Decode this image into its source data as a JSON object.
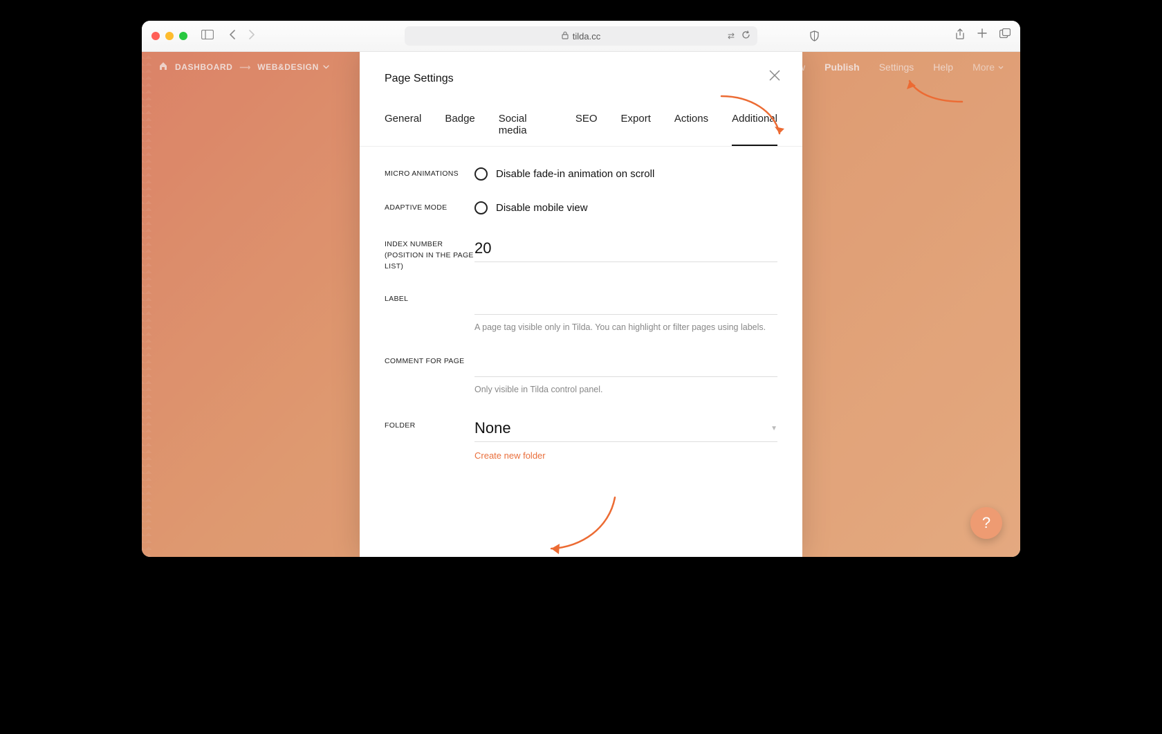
{
  "browser": {
    "url": "tilda.cc"
  },
  "topbar": {
    "dashboard": "DASHBOARD",
    "project": "WEB&DESIGN",
    "preview": "Preview",
    "publish": "Publish",
    "settings": "Settings",
    "help": "Help",
    "more": "More"
  },
  "modal": {
    "title": "Page Settings",
    "tabs": {
      "general": "General",
      "badge": "Badge",
      "social": "Social media",
      "seo": "SEO",
      "export": "Export",
      "actions": "Actions",
      "additional": "Additional"
    },
    "fields": {
      "micro_animations": {
        "label": "MICRO ANIMATIONS",
        "option": "Disable fade-in animation on scroll"
      },
      "adaptive_mode": {
        "label": "ADAPTIVE MODE",
        "option": "Disable mobile view"
      },
      "index": {
        "label": "INDEX NUMBER (POSITION IN THE PAGE LIST)",
        "value": "20"
      },
      "pagelabel": {
        "label": "LABEL",
        "value": "",
        "hint": "A page tag visible only in Tilda. You can highlight or filter pages using labels."
      },
      "comment": {
        "label": "COMMENT FOR PAGE",
        "value": "",
        "hint": "Only visible in Tilda control panel."
      },
      "folder": {
        "label": "FOLDER",
        "value": "None",
        "create_link": "Create new folder"
      }
    }
  },
  "fab": {
    "help": "?"
  }
}
